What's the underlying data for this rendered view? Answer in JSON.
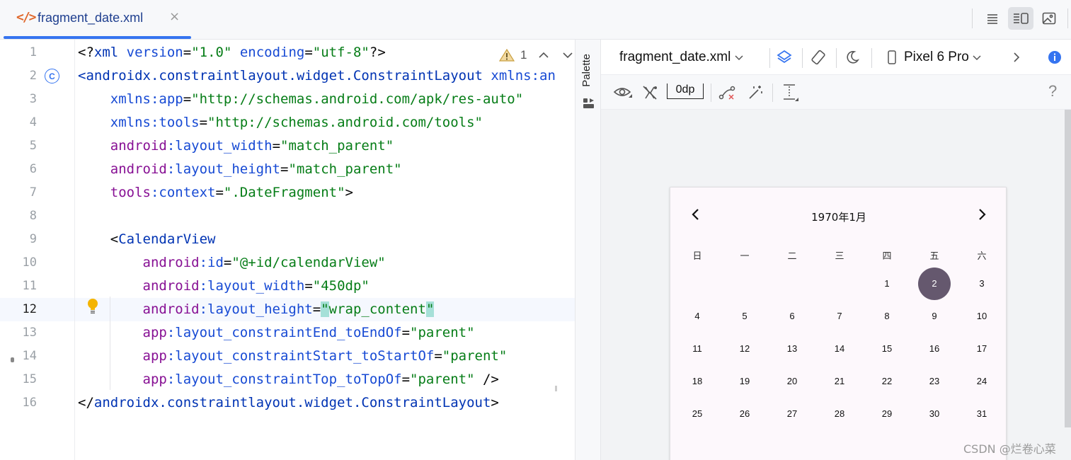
{
  "tab": {
    "icon": "xml-file-icon",
    "label": "fragment_date.xml",
    "close": "×"
  },
  "editor": {
    "lines": [
      {
        "num": "1"
      },
      {
        "num": "2"
      },
      {
        "num": "3"
      },
      {
        "num": "4"
      },
      {
        "num": "5"
      },
      {
        "num": "6"
      },
      {
        "num": "7"
      },
      {
        "num": "8"
      },
      {
        "num": "9"
      },
      {
        "num": "10"
      },
      {
        "num": "11"
      },
      {
        "num": "12"
      },
      {
        "num": "13"
      },
      {
        "num": "14"
      },
      {
        "num": "15"
      },
      {
        "num": "16"
      }
    ],
    "code": {
      "l1a": "<?",
      "l1b": "xml",
      "l1c": " version",
      "l1d": "=",
      "l1e": "\"1.0\"",
      "l1f": " encoding",
      "l1g": "=",
      "l1h": "\"utf-8\"",
      "l1i": "?>",
      "l2a": "<androidx.constraintlayout.widget.ConstraintLayout",
      "l2b": " xmlns:",
      "l2c": "an",
      "l3a": "    xmlns:app",
      "l3b": "=",
      "l3c": "\"http://schemas.android.com/apk/res-auto\"",
      "l4a": "    xmlns:tools",
      "l4b": "=",
      "l4c": "\"http://schemas.android.com/tools\"",
      "l5a": "    android",
      "l5b": ":layout_width",
      "l5c": "=",
      "l5d": "\"match_parent\"",
      "l6a": "    android",
      "l6b": ":layout_height",
      "l6c": "=",
      "l6d": "\"match_parent\"",
      "l7a": "    tools",
      "l7b": ":context",
      "l7c": "=",
      "l7d": "\".DateFragment\"",
      "l7e": ">",
      "l9a": "    <",
      "l9b": "CalendarView",
      "l10a": "        android",
      "l10b": ":id",
      "l10c": "=",
      "l10d": "\"@+id/calendarView\"",
      "l11a": "        android",
      "l11b": ":layout_width",
      "l11c": "=",
      "l11d": "\"450dp\"",
      "l12a": "        android",
      "l12b": ":layout_height",
      "l12c": "=",
      "l12d": "\"",
      "l12e": "wrap_content",
      "l12f": "\"",
      "l13a": "        app",
      "l13b": ":layout_constraintEnd_toEndOf",
      "l13c": "=",
      "l13d": "\"parent\"",
      "l14a": "        app",
      "l14b": ":layout_constraintStart_toStartOf",
      "l14c": "=",
      "l14d": "\"parent\"",
      "l15a": "        app",
      "l15b": ":layout_constraintTop_toTopOf",
      "l15c": "=",
      "l15d": "\"parent\"",
      "l15e": " />",
      "l16a": "</",
      "l16b": "androidx.constraintlayout.widget.ConstraintLayout",
      "l16c": ">"
    },
    "warning_count": "1",
    "class_marker": "C"
  },
  "palette": {
    "label": "Palette"
  },
  "design": {
    "file": "fragment_date.xml",
    "device": "Pixel 6 Pro",
    "margin": "0dp",
    "help": "?"
  },
  "calendar": {
    "title": "1970年1月",
    "weekdays": [
      "日",
      "一",
      "二",
      "三",
      "四",
      "五",
      "六"
    ],
    "selected_day": 2,
    "weeks": [
      [
        "",
        "",
        "",
        "",
        "1",
        "2",
        "3"
      ],
      [
        "4",
        "5",
        "6",
        "7",
        "8",
        "9",
        "10"
      ],
      [
        "11",
        "12",
        "13",
        "14",
        "15",
        "16",
        "17"
      ],
      [
        "18",
        "19",
        "20",
        "21",
        "22",
        "23",
        "24"
      ],
      [
        "25",
        "26",
        "27",
        "28",
        "29",
        "30",
        "31"
      ]
    ]
  },
  "watermark": "CSDN @烂卷心菜",
  "colors": {
    "accent": "#3574f0",
    "selected_day": "#65586e",
    "calendar_bg": "#fdf8fc"
  }
}
